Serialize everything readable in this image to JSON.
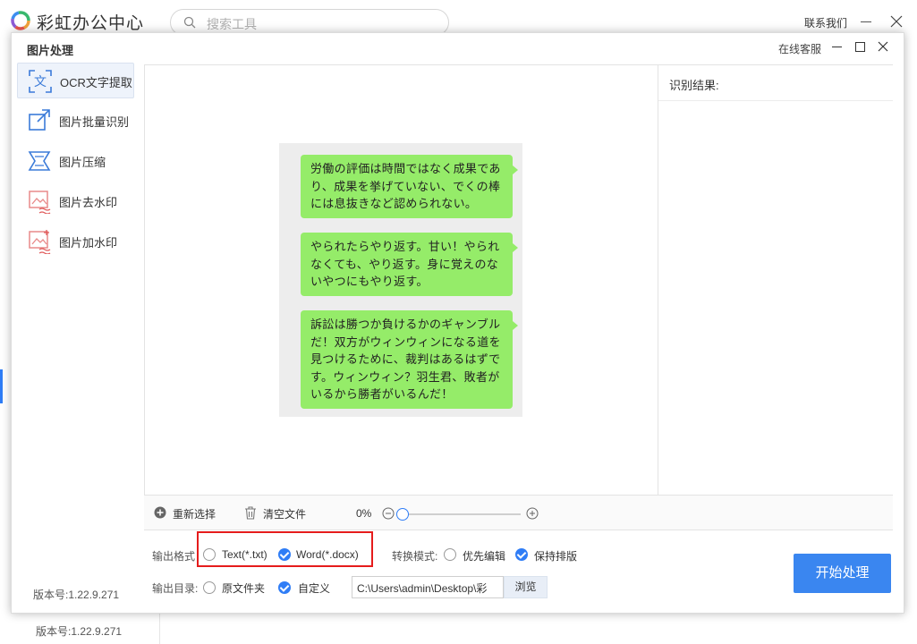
{
  "app": {
    "title": "彩虹办公中心",
    "search_placeholder": "搜索工具",
    "contact": "联系我们",
    "version": "版本号:1.22.9.271"
  },
  "dialog": {
    "title": "图片处理",
    "support": "在线客服"
  },
  "sidebar": {
    "items": [
      {
        "label": "OCR文字提取",
        "icon": "ocr-text-icon",
        "active": true
      },
      {
        "label": "图片批量识别",
        "icon": "batch-recognize-icon",
        "active": false
      },
      {
        "label": "图片压缩",
        "icon": "compress-icon",
        "active": false
      },
      {
        "label": "图片去水印",
        "icon": "remove-watermark-icon",
        "active": false
      },
      {
        "label": "图片加水印",
        "icon": "add-watermark-icon",
        "active": false
      }
    ],
    "version": "版本号:1.22.9.271"
  },
  "preview": {
    "bubbles": [
      "労働の評価は時間ではなく成果であり、成果を挙げていない、でくの棒には息抜きなど認められない。",
      "やられたらやり返す。甘い！やられなくても、やり返す。身に覚えのないやつにもやり返す。",
      "訴訟は勝つか負けるかのギャンブルだ！双方がウィンウィンになる道を見つけるために、裁判はあるはずです。ウィンウィン？羽生君、敗者がいるから勝者がいるんだ！"
    ]
  },
  "result": {
    "label": "识别结果:"
  },
  "toolbar": {
    "reselect": "重新选择",
    "clear": "清空文件",
    "zoom": "0%"
  },
  "options": {
    "format_label": "输出格式",
    "format_txt": "Text(*.txt)",
    "format_docx": "Word(*.docx)",
    "mode_label": "转换模式:",
    "mode_edit": "优先编辑",
    "mode_layout": "保持排版",
    "dir_label": "输出目录:",
    "dir_original": "原文件夹",
    "dir_custom": "自定义",
    "path": "C:\\Users\\admin\\Desktop\\彩",
    "browse": "浏览",
    "start": "开始处理"
  },
  "colors": {
    "accent": "#2f7df6",
    "start_button": "#3a86f0",
    "bubble": "#95ec69",
    "highlight": "#e51c1c"
  }
}
